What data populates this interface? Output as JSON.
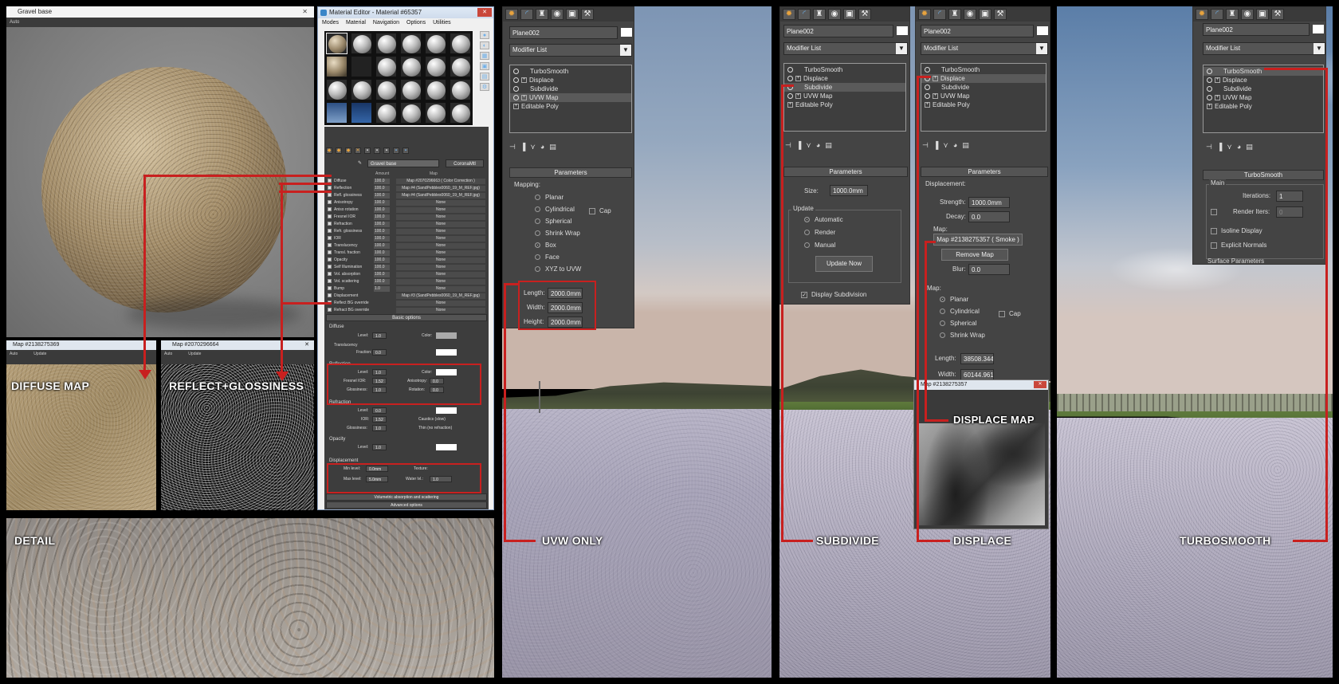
{
  "captions": {
    "diffuse_map": "DIFFUSE MAP",
    "reflect_glossiness": "REFLECT+GLOSSINESS",
    "detail": "DETAIL",
    "uvw_only": "UVW ONLY",
    "subdivide": "SUBDIVIDE",
    "displace": "DISPLACE",
    "displace_map": "DISPLACE MAP",
    "turbosmooth": "TURBOSMOOTH"
  },
  "render_window": {
    "title": "Gravel base",
    "mode": "Auto"
  },
  "material_editor": {
    "title": "Material Editor - Material #65357",
    "menu": [
      "Modes",
      "Material",
      "Navigation",
      "Options",
      "Utilities"
    ],
    "material_name": "Gravel base",
    "material_type": "CoronaMtl",
    "columns": {
      "amount": "Amount",
      "map": "Map"
    },
    "maps": [
      {
        "name": "Diffuse",
        "amount": "100.0",
        "map": "Map #2070296663 ( Color Correction )"
      },
      {
        "name": "Reflection",
        "amount": "100.0",
        "map": "Map #4 (SandPebbles0060_19_M_REF.jpg)"
      },
      {
        "name": "Refl. glossiness",
        "amount": "100.0",
        "map": "Map #4 (SandPebbles0060_19_M_REF.jpg)"
      },
      {
        "name": "Anisotropy",
        "amount": "100.0",
        "map": "None"
      },
      {
        "name": "Aniso rotation",
        "amount": "100.0",
        "map": "None"
      },
      {
        "name": "Fresnel IOR",
        "amount": "100.0",
        "map": "None"
      },
      {
        "name": "Refraction",
        "amount": "100.0",
        "map": "None"
      },
      {
        "name": "Refr. glossiness",
        "amount": "100.0",
        "map": "None"
      },
      {
        "name": "IOR",
        "amount": "100.0",
        "map": "None"
      },
      {
        "name": "Translucency",
        "amount": "100.0",
        "map": "None"
      },
      {
        "name": "Transl. fraction",
        "amount": "100.0",
        "map": "None"
      },
      {
        "name": "Opacity",
        "amount": "100.0",
        "map": "None"
      },
      {
        "name": "Self Illumination",
        "amount": "100.0",
        "map": "None"
      },
      {
        "name": "Vol. absorption",
        "amount": "100.0",
        "map": "None"
      },
      {
        "name": "Vol. scattering",
        "amount": "100.0",
        "map": "None"
      },
      {
        "name": "Bump",
        "amount": "1.0",
        "map": "None"
      },
      {
        "name": "Displacement",
        "amount": "",
        "map": "Map #3 (SandPebbles0060_19_M_REF.jpg)"
      },
      {
        "name": "Reflect BG override",
        "amount": "",
        "map": "None"
      },
      {
        "name": "Refract BG override",
        "amount": "",
        "map": "None"
      }
    ],
    "basic_options": {
      "header": "Basic options",
      "diffuse_label": "Diffuse",
      "level_label": "Level:",
      "color_label": "Color:",
      "translucency_label": "Translucency",
      "fraction_label": "Fraction:",
      "reflection_label": "Reflection",
      "fresnel_label": "Fresnel IOR:",
      "fresnel_value": "1.52",
      "anisotropy_label": "Anisotropy:",
      "glossiness_label": "Glossiness:",
      "rotation_label": "Rotation:",
      "refraction_label": "Refraction",
      "ior_label": "IOR:",
      "ior_value": "1.52",
      "caustics_label": "Caustics (slow)",
      "thin_label": "Thin (no refraction)",
      "opacity_label": "Opacity",
      "displacement_label": "Displacement",
      "min_level_label": "Min level:",
      "min_level": "0.0mm",
      "max_level_label": "Max level:",
      "max_level": "5.0mm",
      "texture_label": "Texture:",
      "water_level_label": "Water lvl.:",
      "volumetric_label": "Volumetric absorption and scattering",
      "advanced_label": "Advanced options",
      "level_value": "1.0",
      "zero_value": "0.0"
    }
  },
  "diffuse_window": {
    "title": "Map #2138275369",
    "mode": "Auto",
    "btn": "Update"
  },
  "reflect_window": {
    "title": "Map #2070296664",
    "mode": "Auto",
    "btn": "Update"
  },
  "panel_uvw": {
    "object_name": "Plane002",
    "modifier_list": "Modifier List",
    "stack": [
      "TurboSmooth",
      "Displace",
      "Subdivide",
      "UVW Map",
      "Editable Poly"
    ],
    "params_header": "Parameters",
    "mapping_label": "Mapping:",
    "mapping_options": [
      "Planar",
      "Cylindrical",
      "Spherical",
      "Shrink Wrap",
      "Box",
      "Face",
      "XYZ to UVW"
    ],
    "cap_label": "Cap",
    "length_label": "Length:",
    "length_value": "2000.0mm",
    "width_label": "Width:",
    "width_value": "2000.0mm",
    "height_label": "Height:",
    "height_value": "2000.0mm"
  },
  "panel_subdivide": {
    "object_name": "Plane002",
    "modifier_list": "Modifier List",
    "stack": [
      "TurboSmooth",
      "Displace",
      "Subdivide",
      "UVW Map",
      "Editable Poly"
    ],
    "params_header": "Parameters",
    "size_label": "Size:",
    "size_value": "1000.0mm",
    "update_label": "Update",
    "update_options": [
      "Automatic",
      "Render",
      "Manual"
    ],
    "update_now": "Update Now",
    "display_subdivision": "Display Subdivision"
  },
  "panel_displace": {
    "object_name": "Plane002",
    "modifier_list": "Modifier List",
    "stack": [
      "TurboSmooth",
      "Displace",
      "Subdivide",
      "UVW Map",
      "Editable Poly"
    ],
    "params_header": "Parameters",
    "displacement_label": "Displacement:",
    "strength_label": "Strength:",
    "strength_value": "1000.0mm",
    "decay_label": "Decay:",
    "decay_value": "0.0",
    "map_label": "Map:",
    "map_button": "Map #2138275357  ( Smoke )",
    "remove_map": "Remove Map",
    "blur_label": "Blur:",
    "blur_value": "0.0",
    "map2_label": "Map:",
    "map_options": [
      "Planar",
      "Cylindrical",
      "Spherical",
      "Shrink Wrap"
    ],
    "cap_label": "Cap",
    "length_label": "Length:",
    "length_value": "38508.344",
    "width_label": "Width:",
    "width_value": "60144.961r",
    "map_window_title": "Map #2138275357"
  },
  "panel_turbosmooth": {
    "object_name": "Plane002",
    "modifier_list": "Modifier List",
    "stack": [
      "TurboSmooth",
      "Displace",
      "Subdivide",
      "UVW Map",
      "Editable Poly"
    ],
    "header": "TurboSmooth",
    "main_label": "Main",
    "iterations_label": "Iterations:",
    "iterations_value": "1",
    "render_iters_label": "Render Iters:",
    "render_iters_value": "0",
    "isoline_label": "Isoline Display",
    "explicit_normals_label": "Explicit Normals",
    "surface_params": "Surface Parameters"
  },
  "colors": {
    "annotation_red": "#c8201f",
    "panel_gray": "#444444"
  }
}
